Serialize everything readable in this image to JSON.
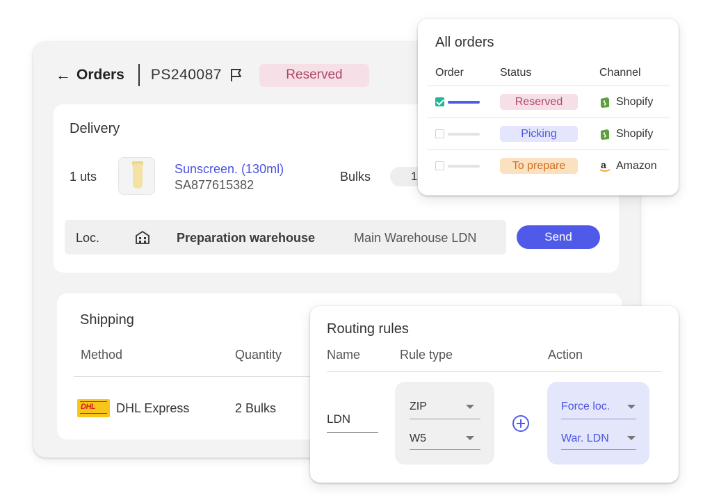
{
  "header": {
    "back_label": "Orders",
    "order_id": "PS240087",
    "status": "Reserved"
  },
  "delivery": {
    "title": "Delivery",
    "qty": "1 uts",
    "product_name": "Sunscreen. (130ml)",
    "product_sku": "SA877615382",
    "bulks_label": "Bulks",
    "bulks_value": "1",
    "loc_label": "Loc.",
    "prep_label": "Preparation warehouse",
    "warehouse": "Main Warehouse LDN",
    "send_label": "Send"
  },
  "shipping": {
    "title": "Shipping",
    "col_method": "Method",
    "col_quantity": "Quantity",
    "method": "DHL Express",
    "quantity": "2 Bulks",
    "logo_text": "DHL"
  },
  "all_orders": {
    "title": "All orders",
    "columns": [
      "Order",
      "Status",
      "Channel"
    ],
    "rows": [
      {
        "checked": true,
        "status": "Reserved",
        "channel": "Shopify"
      },
      {
        "checked": false,
        "status": "Picking",
        "channel": "Shopify"
      },
      {
        "checked": false,
        "status": "To prepare",
        "channel": "Amazon"
      }
    ]
  },
  "routing": {
    "title": "Routing rules",
    "col_name": "Name",
    "col_rule": "Rule type",
    "col_action": "Action",
    "name_value": "LDN",
    "rule_type": "ZIP",
    "rule_value": "W5",
    "action_type": "Force loc.",
    "action_value": "War. LDN"
  },
  "colors": {
    "accent": "#4f5be8",
    "reserved_bg": "#f6dfe6",
    "reserved_text": "#b04866",
    "picking_bg": "#e3e6fc",
    "prepare_bg": "#fbe1bf",
    "check_green": "#1fb89a"
  },
  "icons": [
    "back-arrow-icon",
    "flag-icon",
    "warehouse-icon",
    "shopify-icon",
    "amazon-icon",
    "plus-circle-icon",
    "dropdown-caret-icon"
  ]
}
